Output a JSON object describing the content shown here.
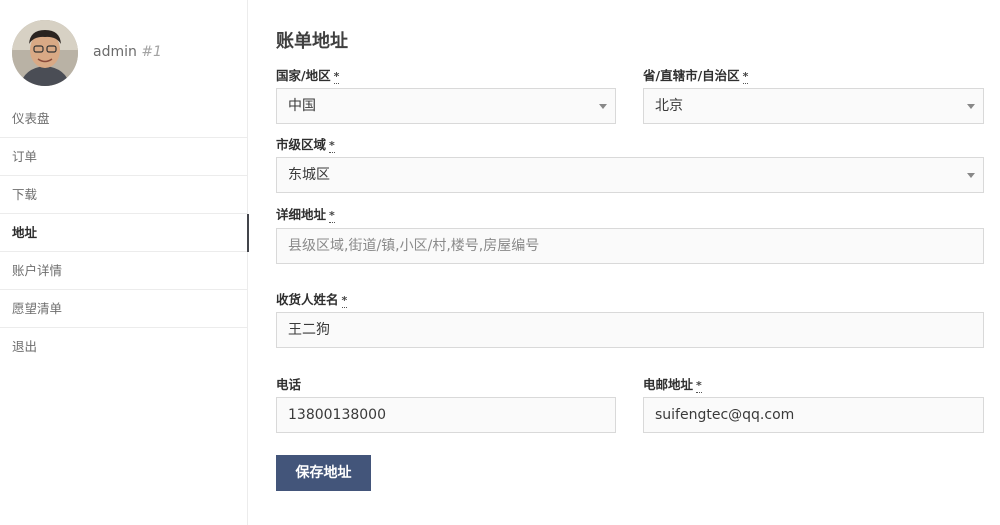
{
  "user": {
    "name": "admin",
    "id": "#1"
  },
  "menu": [
    {
      "label": "仪表盘"
    },
    {
      "label": "订单"
    },
    {
      "label": "下载"
    },
    {
      "label": "地址"
    },
    {
      "label": "账户详情"
    },
    {
      "label": "愿望清单"
    },
    {
      "label": "退出"
    }
  ],
  "form": {
    "title": "账单地址",
    "required_mark": "*",
    "country": {
      "label": "国家/地区",
      "value": "中国"
    },
    "province": {
      "label": "省/直辖市/自治区",
      "value": "北京"
    },
    "district": {
      "label": "市级区域",
      "value": "东城区"
    },
    "address": {
      "label": "详细地址",
      "placeholder": "县级区域,街道/镇,小区/村,楼号,房屋编号"
    },
    "recipient": {
      "label": "收货人姓名",
      "value": "王二狗"
    },
    "phone": {
      "label": "电话",
      "value": "13800138000"
    },
    "email": {
      "label": "电邮地址",
      "value": "suifengtec@qq.com"
    },
    "save_label": "保存地址"
  },
  "colors": {
    "button": "#43557a",
    "active_indicator": "#43454b"
  },
  "icons": {
    "dropdown": "chevron-down-icon"
  }
}
